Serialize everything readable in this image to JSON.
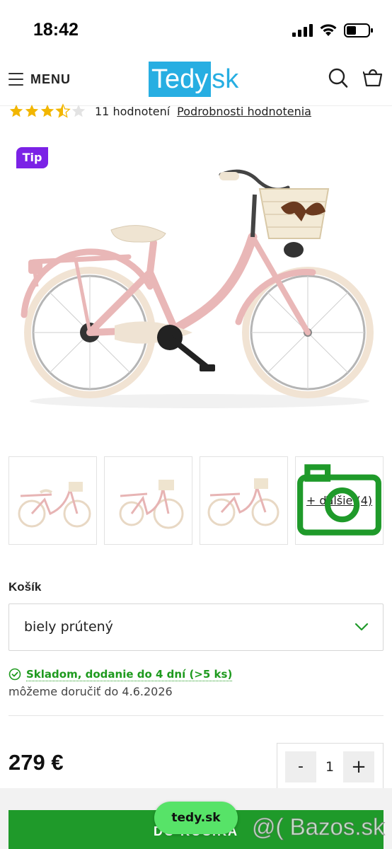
{
  "status_bar": {
    "time": "18:42"
  },
  "header": {
    "menu_label": "MENU",
    "logo_box": "Tedy",
    "logo_tail": "sk",
    "brand_color": "#27aee2"
  },
  "rating": {
    "stars": 3.5,
    "max_stars": 5,
    "count_label": "11 hodnotení",
    "details_link": "Podrobnosti hodnotenia"
  },
  "product": {
    "badge": "Tip",
    "more_images_label": "+ ďalšie (4)",
    "option_label": "Košík",
    "option_value": "biely prútený",
    "stock_text": "Skladom, dodanie do 4 dní (>5 ks)",
    "delivery_text": "môžeme doručiť do 4.6.2026",
    "price": "279 €",
    "quantity": "1",
    "qty_minus": "-",
    "qty_plus": "+",
    "add_to_cart": "DO KOŠÍKA"
  },
  "browser": {
    "url_pill": "tedy.sk"
  },
  "watermark": "@( Bazos.sk",
  "colors": {
    "accent_green": "#1f9a2a",
    "badge_purple": "#7b22e6",
    "star_gold": "#f2b600",
    "bike_pink": "#e9b7b7"
  }
}
